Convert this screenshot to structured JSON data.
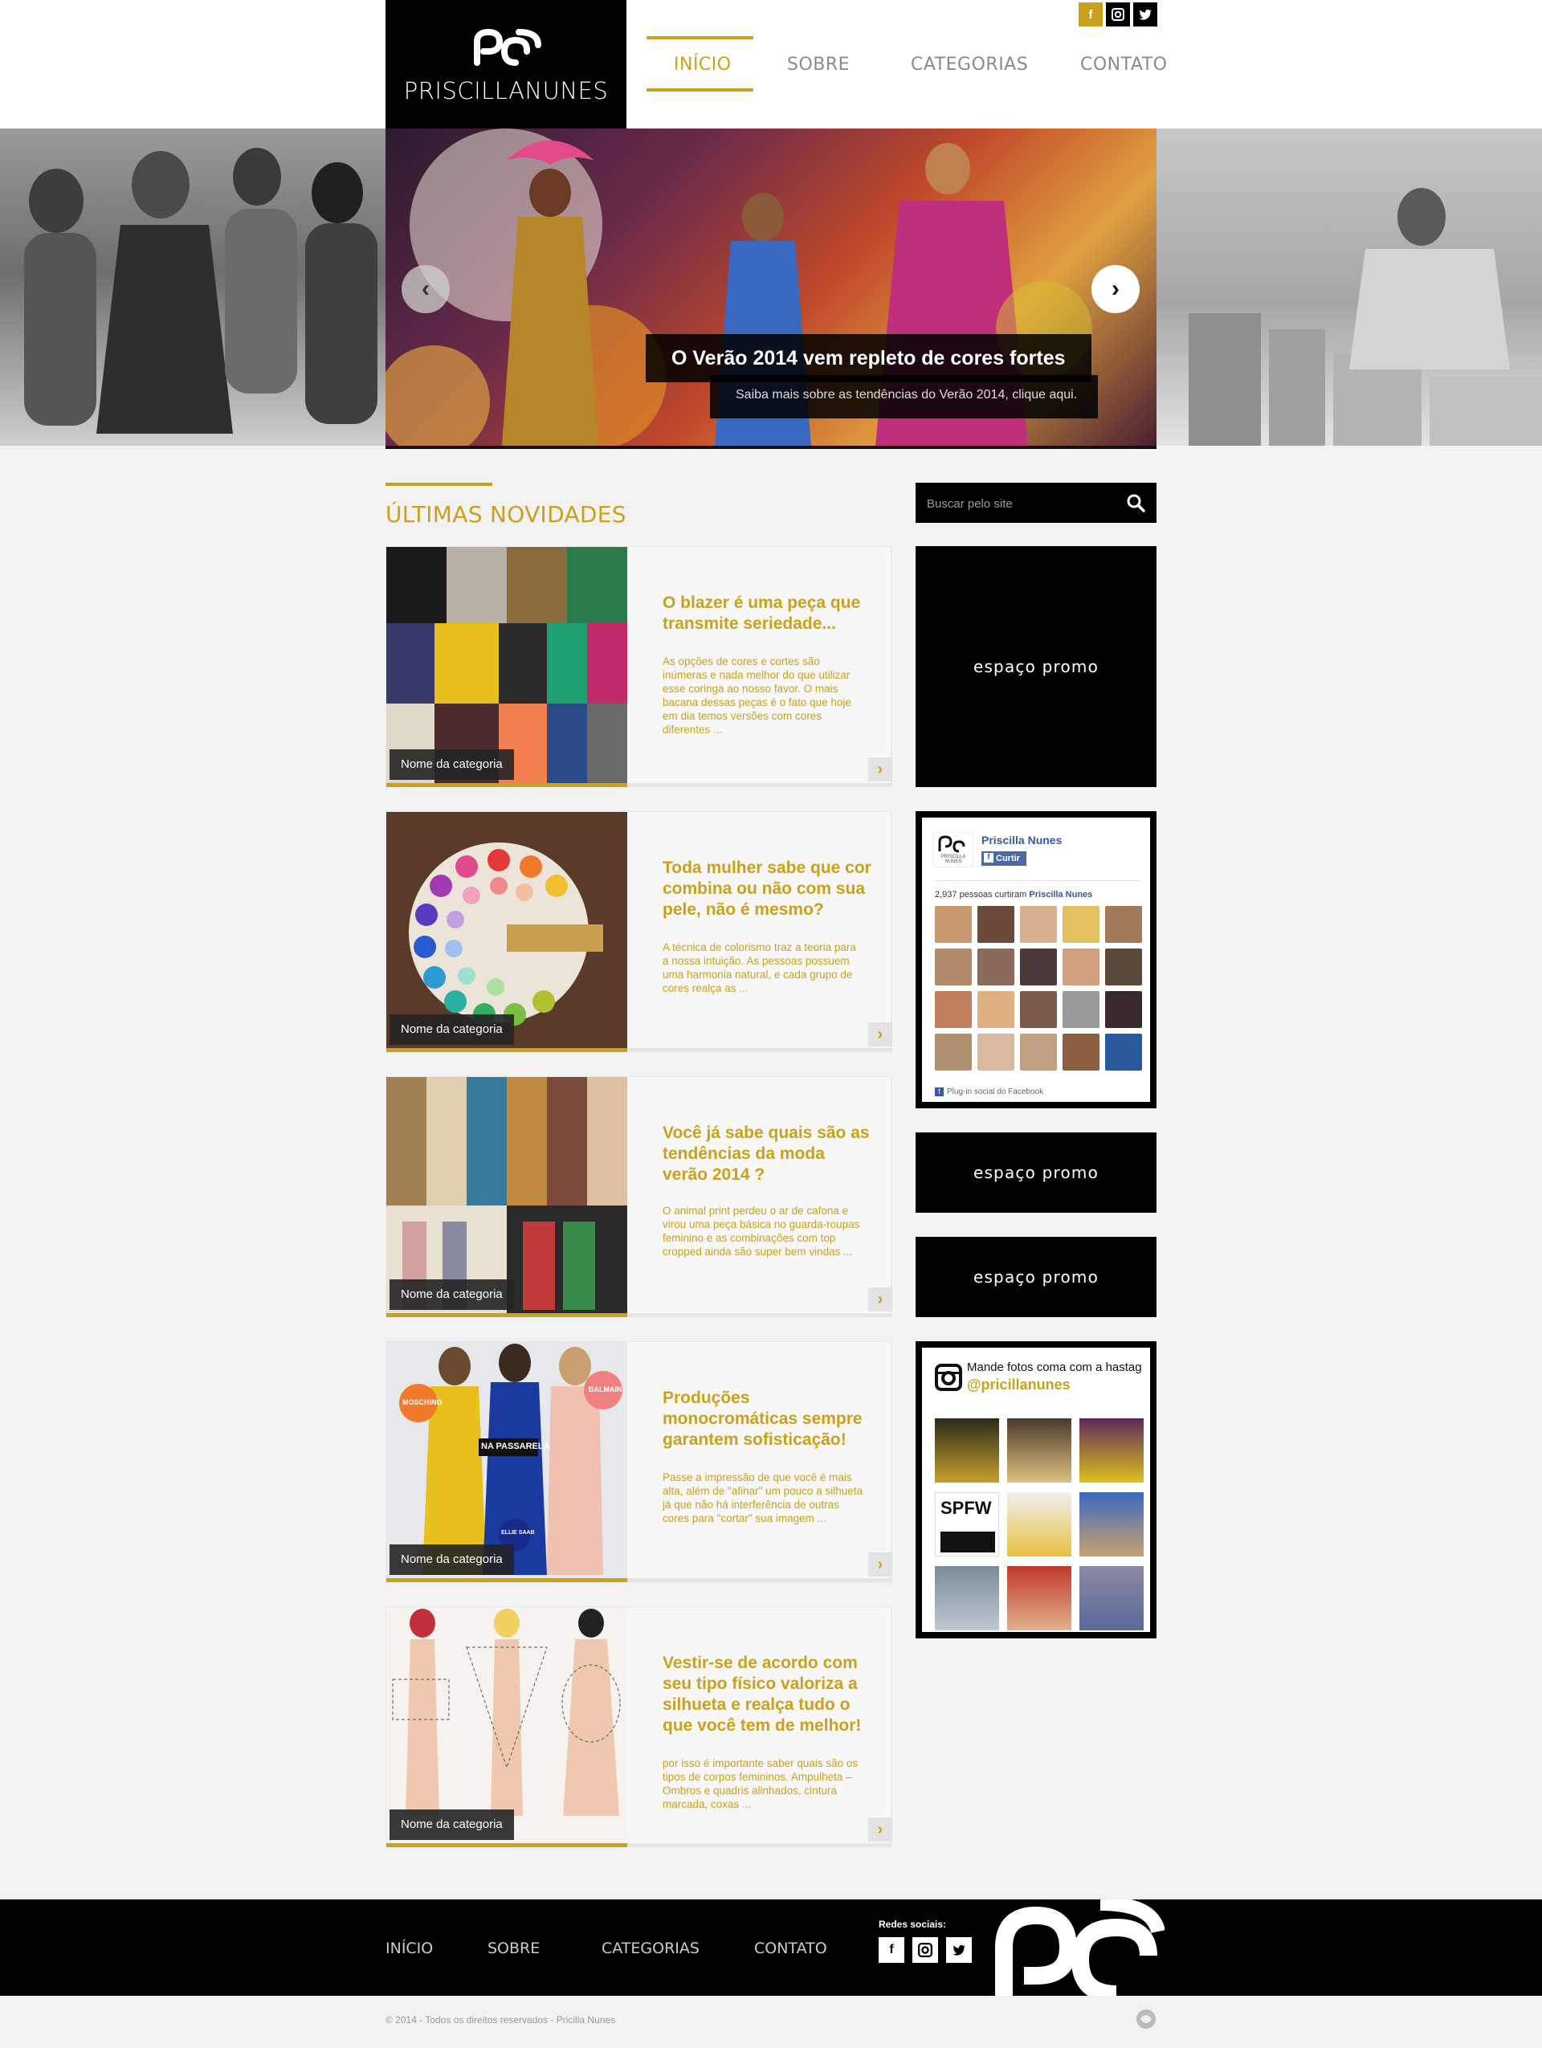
{
  "brand": {
    "name": "PRISCILLANUNES",
    "gold": "#c9a11c"
  },
  "nav": [
    {
      "label": "INÍCIO",
      "active": true
    },
    {
      "label": "SOBRE",
      "active": false
    },
    {
      "label": "CATEGORIAS",
      "active": false
    },
    {
      "label": "CONTATO",
      "active": false
    }
  ],
  "top_social": [
    "facebook-icon",
    "instagram-icon",
    "twitter-icon"
  ],
  "slider": {
    "title": "O Verão 2014 vem repleto de cores fortes",
    "subtitle": "Saiba mais sobre as tendências do Verão 2014, clique aqui."
  },
  "section_title": "ÚLTIMAS NOVIDADES",
  "posts": [
    {
      "category": "Nome da categoria",
      "title": "O blazer é uma peça que transmite seriedade...",
      "excerpt": "As opções de cores e cortes são inúmeras e nada melhor do que utilizar esse coringa ao nosso favor. O mais bacana dessas peças é o fato que hoje em dia temos versões com cores diferentes ..."
    },
    {
      "category": "Nome da categoria",
      "title": "Toda mulher sabe que cor combina ou não com sua pele, não é mesmo?",
      "excerpt": "A técnica de colorismo traz a teoria para a nossa intuição. As pessoas possuem uma harmonia natural, e cada grupo de cores realça as ..."
    },
    {
      "category": "Nome da categoria",
      "title": "Você já sabe quais são as tendências da moda verão 2014 ?",
      "excerpt": "O animal print perdeu o ar de cafona e virou uma peça básica no guarda-roupas feminino e as combinações com top cropped ainda são super bem vindas ..."
    },
    {
      "category": "Nome da categoria",
      "title": "Produções monocromáticas sempre garantem sofisticação!",
      "excerpt": "Passe a impressão de que você é mais alta, além de \"afinar\" um pouco a silhueta já que não há interferência de outras cores para \"cortar\" sua imagem ...",
      "image_labels": {
        "left": "MOSCHINO",
        "right": "BALMAIN",
        "center": "NA PASSARELA",
        "bottom": "ELLIE SAAB"
      }
    },
    {
      "category": "Nome da categoria",
      "title": "Vestir-se de acordo com seu tipo físico valoriza a silhueta e realça tudo o que você tem de melhor!",
      "excerpt": "por isso é importante saber quais são os tipos de corpos femininos. Ampulheta – Ombros e quadris alinhados, cintura marcada, coxas ..."
    }
  ],
  "sidebar": {
    "search_placeholder": "Buscar pelo site",
    "promo_label": "espaço promo",
    "facebook": {
      "page_name": "Priscilla Nunes",
      "logo_text": "PRISCILLA NUNES",
      "like_label": "Curtir",
      "count_text": "2,937 pessoas curtiram",
      "count_name": "Priscilla Nunes",
      "plugin_text": "Plug-in social do Facebook"
    },
    "instagram": {
      "line1": "Mande fotos coma com a hastag",
      "line2": "@pricillanunes",
      "thumb_text": "SPFW"
    }
  },
  "footer": {
    "nav": [
      "INÍCIO",
      "SOBRE",
      "CATEGORIAS",
      "CONTATO"
    ],
    "social_label": "Redes sociais:",
    "copyright": "© 2014 - Todos os direitos reservados - Pricilla Nunes"
  }
}
